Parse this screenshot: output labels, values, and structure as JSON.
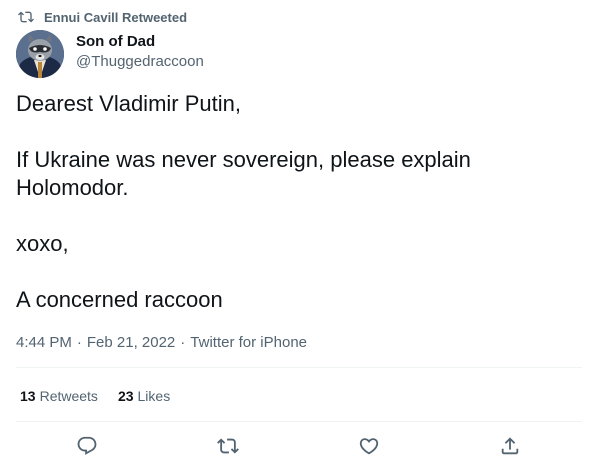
{
  "retweet_context": {
    "text": "Ennui Cavill Retweeted",
    "icon": "retweet-icon"
  },
  "author": {
    "display_name": "Son of Dad",
    "handle": "@Thuggedraccoon",
    "avatar": "raccoon-avatar"
  },
  "tweet": {
    "paragraphs": [
      "Dearest Vladimir Putin,",
      "If Ukraine was never sovereign, please explain Holomodor.",
      "xoxo,",
      "A concerned raccoon"
    ]
  },
  "meta": {
    "time": "4:44 PM",
    "separator": "·",
    "date": "Feb 21, 2022",
    "source": "Twitter for iPhone"
  },
  "stats": {
    "retweets_count": "13",
    "retweets_label": "Retweets",
    "likes_count": "23",
    "likes_label": "Likes"
  },
  "actions": [
    {
      "name": "reply",
      "icon": "reply-icon"
    },
    {
      "name": "retweet",
      "icon": "retweet-icon"
    },
    {
      "name": "like",
      "icon": "heart-icon"
    },
    {
      "name": "share",
      "icon": "share-icon"
    }
  ],
  "colors": {
    "text_primary": "#0f1419",
    "text_secondary": "#536471",
    "divider": "#eff3f4"
  }
}
